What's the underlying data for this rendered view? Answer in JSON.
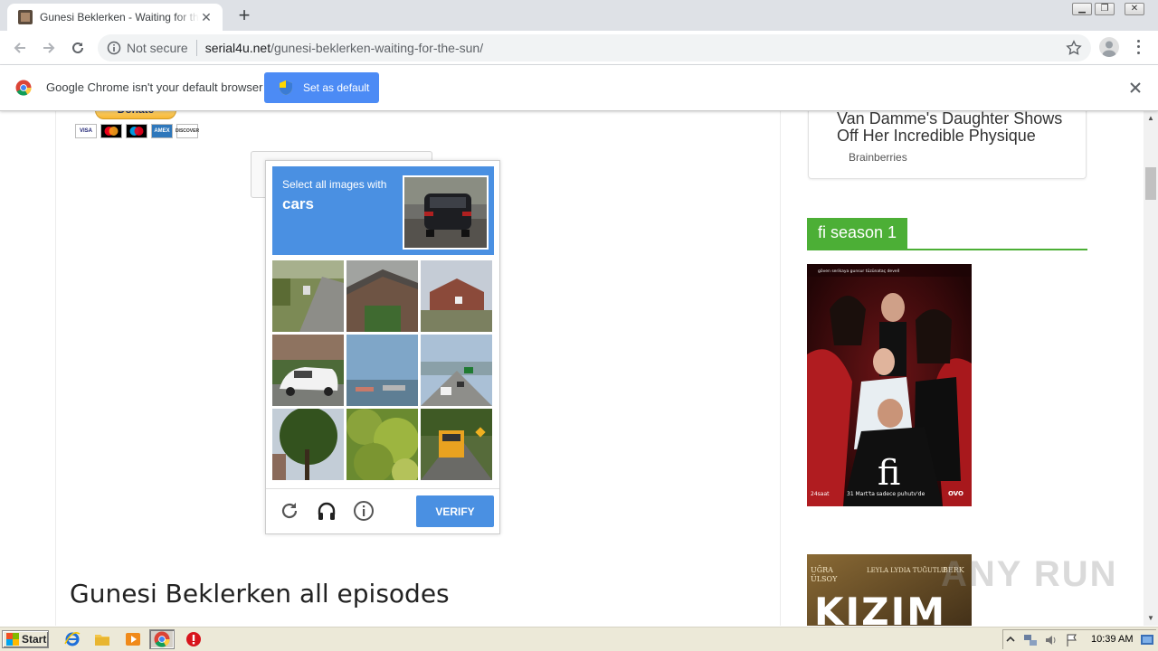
{
  "browser": {
    "tab_title": "Gunesi Beklerken - Waiting for the Sun",
    "security_label": "Not secure",
    "url_host": "serial4u.net",
    "url_path": "/gunesi-beklerken-waiting-for-the-sun/"
  },
  "infobar": {
    "message": "Google Chrome isn't your default browser",
    "button_label": "Set as default"
  },
  "page": {
    "donate_label": "Donate",
    "cards": [
      "VISA",
      "MC",
      "MAESTRO",
      "AMEX",
      "DISCOVER"
    ],
    "heading": "Gunesi Beklerken all episodes"
  },
  "captcha": {
    "instruction": "Select all images with",
    "target": "cars",
    "verify_label": "VERIFY",
    "tiles": [
      "street-driveway",
      "house-roof",
      "brick-house",
      "white-car",
      "ships-water",
      "highway-traffic",
      "tree-house",
      "green-foliage",
      "school-bus-road"
    ]
  },
  "sidebar": {
    "ad_title": "Van Damme's Daughter Shows Off Her Incredible Physique",
    "ad_source": "Brainberries",
    "section_title": "fi season 1",
    "poster1_logo": "fi",
    "poster1_caption": "31 Mart'ta sadece puhutv'de",
    "poster2_title": "KIZIM",
    "poster2_names": [
      "UĞRA",
      "LEYLA LYDIA TUĞUTLU",
      "BERK"
    ],
    "watermark": "ANY RUN"
  },
  "taskbar": {
    "start_label": "Start",
    "clock": "10:39 AM"
  },
  "colors": {
    "accent_blue": "#4a90e2",
    "section_green": "#4caf36",
    "infobar_button": "#4c8bf5"
  }
}
